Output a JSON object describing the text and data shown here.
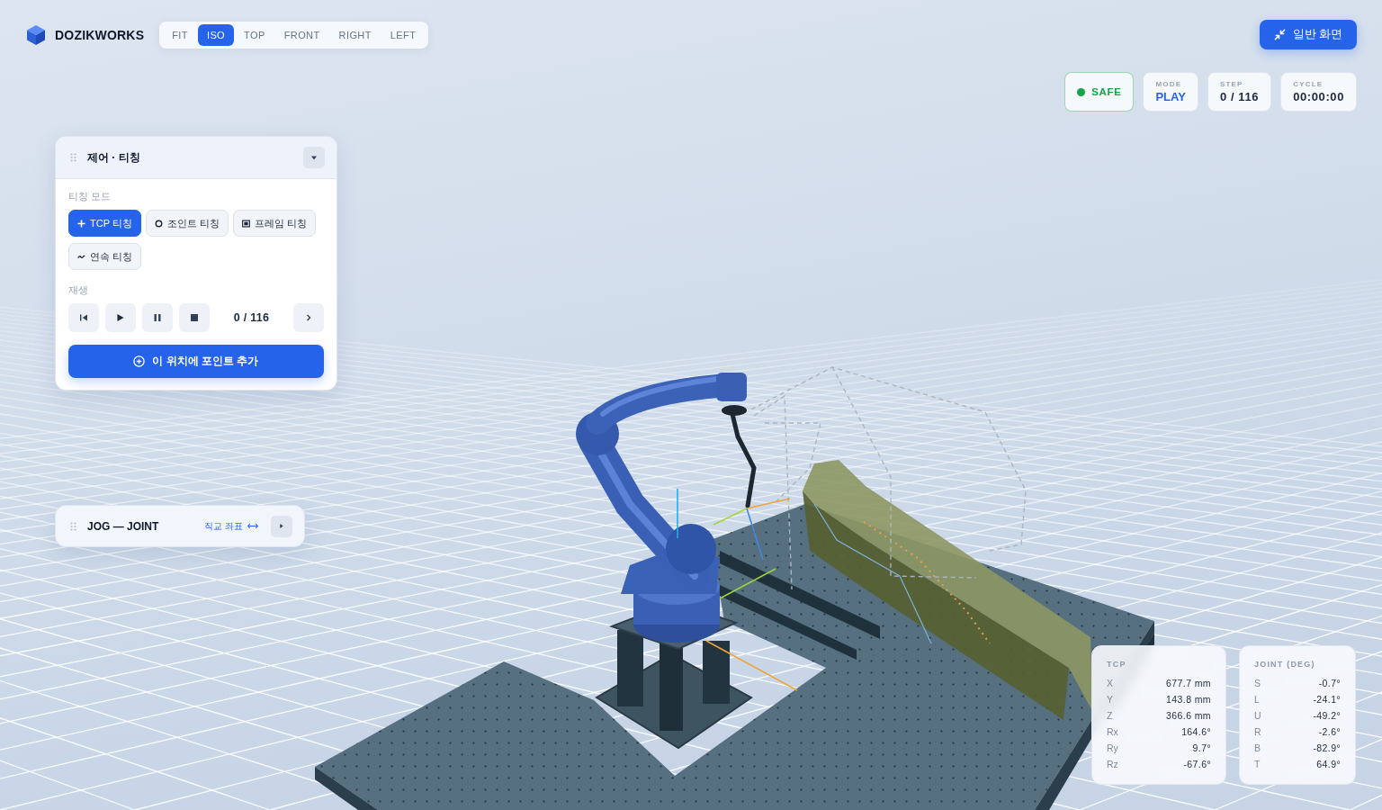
{
  "brand": {
    "name": "DOZIKWORKS"
  },
  "view_tabs": [
    {
      "label": "FIT",
      "selected": false
    },
    {
      "label": "ISO",
      "selected": true
    },
    {
      "label": "TOP",
      "selected": false
    },
    {
      "label": "FRONT",
      "selected": false
    },
    {
      "label": "RIGHT",
      "selected": false
    },
    {
      "label": "LEFT",
      "selected": false
    }
  ],
  "normal_view_button": {
    "label": "일반 화면"
  },
  "status_cards": [
    {
      "kind": "safety",
      "value": "SAFE",
      "color": "#16a34a"
    },
    {
      "kind": "mode",
      "label": "MODE",
      "value": "PLAY"
    },
    {
      "kind": "counter",
      "label": "STEP",
      "value": "0 / 116"
    },
    {
      "kind": "counter",
      "label": "CYCLE",
      "value": "00:00:00"
    }
  ],
  "control_panel": {
    "title": "제어 · 티칭",
    "expanded": true,
    "teach_mode": {
      "label": "티칭 모드",
      "options": [
        {
          "kind": "tcp",
          "label": "TCP 티칭",
          "selected": true
        },
        {
          "kind": "joint",
          "label": "조인트 티칭",
          "selected": false
        },
        {
          "kind": "frame",
          "label": "프레임 티칭",
          "selected": false
        },
        {
          "kind": "continuous",
          "label": "연속 티칭",
          "selected": false
        }
      ]
    },
    "playback": {
      "label": "재생",
      "counter": "0 / 116"
    },
    "add_point_button": {
      "label": "이 위치에 포인트 추가"
    }
  },
  "jog_panel": {
    "title": "JOG — JOINT",
    "expanded": false,
    "frame_toggle": {
      "label": "직교 좌표"
    }
  },
  "tcp_readout": {
    "title": "TCP",
    "rows": [
      {
        "axis": "X",
        "value": "677.7 mm"
      },
      {
        "axis": "Y",
        "value": "143.8 mm"
      },
      {
        "axis": "Z",
        "value": "366.6 mm"
      },
      {
        "axis": "Rx",
        "value": "164.6°"
      },
      {
        "axis": "Ry",
        "value": "9.7°"
      },
      {
        "axis": "Rz",
        "value": "-67.6°"
      }
    ]
  },
  "joint_readout": {
    "title": "JOINT (DEG)",
    "rows": [
      {
        "axis": "S",
        "value": "-0.7°"
      },
      {
        "axis": "L",
        "value": "-24.1°"
      },
      {
        "axis": "U",
        "value": "-49.2°"
      },
      {
        "axis": "R",
        "value": "-2.6°"
      },
      {
        "axis": "B",
        "value": "-82.9°"
      },
      {
        "axis": "T",
        "value": "64.9°"
      }
    ]
  }
}
